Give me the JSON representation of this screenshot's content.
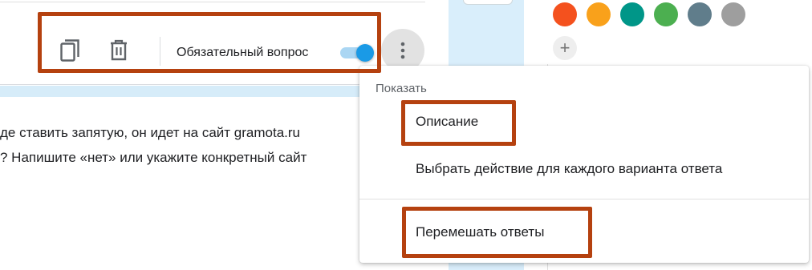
{
  "toolbar": {
    "copy_icon": "copy-icon",
    "delete_icon": "trash-icon",
    "required_label": "Обязательный вопрос",
    "required_enabled": true,
    "more_icon": "more-vertical-icon"
  },
  "question_body": {
    "line1": "де ставить запятую, он идет на сайт gramota.ru",
    "line2": "? Напишите «нет» или укажите конкретный сайт"
  },
  "color_palette": {
    "colors": [
      "#f4511e",
      "#f9a11b",
      "#009688",
      "#4caf50",
      "#607d8b",
      "#9e9e9e"
    ],
    "add_label": "+"
  },
  "menu": {
    "header": "Показать",
    "items": [
      {
        "label": "Описание"
      },
      {
        "label": "Выбрать действие для каждого варианта ответа"
      },
      {
        "label": "Перемешать ответы"
      }
    ]
  },
  "highlight_color": "#b5410f"
}
